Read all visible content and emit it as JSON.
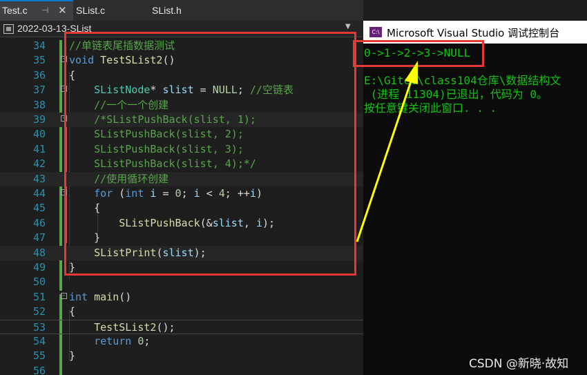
{
  "tabs": [
    {
      "label": "Test.c",
      "active": true
    },
    {
      "label": "SList.c",
      "active": false
    },
    {
      "label": "SList.h",
      "active": false
    }
  ],
  "tab_pin": "⊣",
  "tab_close": "✕",
  "nav": {
    "project": "2022-03-13-SList"
  },
  "code_lines": [
    {
      "num": "34",
      "tokens": [
        {
          "t": "//单链表尾插数据测试",
          "c": "c"
        }
      ]
    },
    {
      "num": "35",
      "fold": "-",
      "tokens": [
        {
          "t": "void ",
          "c": "k"
        },
        {
          "t": "TestSList2",
          "c": "f"
        },
        {
          "t": "()",
          "c": ""
        }
      ]
    },
    {
      "num": "36",
      "tokens": [
        {
          "t": "{",
          "c": ""
        }
      ]
    },
    {
      "num": "37",
      "fold": "-",
      "tokens": [
        {
          "t": "    ",
          "c": ""
        },
        {
          "t": "SListNode",
          "c": "t"
        },
        {
          "t": "* ",
          "c": ""
        },
        {
          "t": "slist",
          "c": "v"
        },
        {
          "t": " = ",
          "c": ""
        },
        {
          "t": "NULL",
          "c": "m"
        },
        {
          "t": "; ",
          "c": ""
        },
        {
          "t": "//空链表",
          "c": "c"
        }
      ]
    },
    {
      "num": "38",
      "tokens": [
        {
          "t": "    ",
          "c": ""
        },
        {
          "t": "//一个一个创建",
          "c": "c"
        }
      ]
    },
    {
      "num": "39",
      "fold": "-",
      "tokens": [
        {
          "t": "    ",
          "c": ""
        },
        {
          "t": "/*SListPushBack(slist, 1);",
          "c": "c"
        }
      ]
    },
    {
      "num": "40",
      "tokens": [
        {
          "t": "    ",
          "c": ""
        },
        {
          "t": "SListPushBack(slist, 2);",
          "c": "c"
        }
      ]
    },
    {
      "num": "41",
      "tokens": [
        {
          "t": "    ",
          "c": ""
        },
        {
          "t": "SListPushBack(slist, 3);",
          "c": "c"
        }
      ]
    },
    {
      "num": "42",
      "tokens": [
        {
          "t": "    ",
          "c": ""
        },
        {
          "t": "SListPushBack(slist, 4);*/",
          "c": "c"
        }
      ]
    },
    {
      "num": "43",
      "tokens": [
        {
          "t": "    ",
          "c": ""
        },
        {
          "t": "//使用循环创建",
          "c": "c"
        }
      ]
    },
    {
      "num": "44",
      "fold": "-",
      "tokens": [
        {
          "t": "    ",
          "c": ""
        },
        {
          "t": "for",
          "c": "k"
        },
        {
          "t": " (",
          "c": ""
        },
        {
          "t": "int",
          "c": "k"
        },
        {
          "t": " ",
          "c": ""
        },
        {
          "t": "i",
          "c": "v"
        },
        {
          "t": " = ",
          "c": ""
        },
        {
          "t": "0",
          "c": "n"
        },
        {
          "t": "; ",
          "c": ""
        },
        {
          "t": "i",
          "c": "v"
        },
        {
          "t": " < ",
          "c": ""
        },
        {
          "t": "4",
          "c": "n"
        },
        {
          "t": "; ++",
          "c": ""
        },
        {
          "t": "i",
          "c": "v"
        },
        {
          "t": ")",
          "c": ""
        }
      ]
    },
    {
      "num": "45",
      "tokens": [
        {
          "t": "    {",
          "c": ""
        }
      ]
    },
    {
      "num": "46",
      "tokens": [
        {
          "t": "        ",
          "c": ""
        },
        {
          "t": "SListPushBack",
          "c": "f"
        },
        {
          "t": "(&",
          "c": ""
        },
        {
          "t": "slist",
          "c": "v"
        },
        {
          "t": ", ",
          "c": ""
        },
        {
          "t": "i",
          "c": "v"
        },
        {
          "t": ");",
          "c": ""
        }
      ]
    },
    {
      "num": "47",
      "tokens": [
        {
          "t": "    }",
          "c": ""
        }
      ]
    },
    {
      "num": "48",
      "tokens": [
        {
          "t": "    ",
          "c": ""
        },
        {
          "t": "SListPrint",
          "c": "f"
        },
        {
          "t": "(",
          "c": ""
        },
        {
          "t": "slist",
          "c": "v"
        },
        {
          "t": ");",
          "c": ""
        }
      ]
    },
    {
      "num": "49",
      "tokens": [
        {
          "t": "}",
          "c": ""
        }
      ]
    },
    {
      "num": "50",
      "tokens": []
    },
    {
      "num": "51",
      "fold": "-",
      "tokens": [
        {
          "t": "int",
          "c": "k"
        },
        {
          "t": " ",
          "c": ""
        },
        {
          "t": "main",
          "c": "f"
        },
        {
          "t": "()",
          "c": ""
        }
      ]
    },
    {
      "num": "52",
      "tokens": [
        {
          "t": "{",
          "c": ""
        }
      ]
    },
    {
      "num": "53",
      "tokens": [
        {
          "t": "    ",
          "c": ""
        },
        {
          "t": "TestSList2",
          "c": "f"
        },
        {
          "t": "();",
          "c": ""
        }
      ]
    },
    {
      "num": "54",
      "tokens": [
        {
          "t": "    ",
          "c": ""
        },
        {
          "t": "return",
          "c": "k"
        },
        {
          "t": " ",
          "c": ""
        },
        {
          "t": "0",
          "c": "n"
        },
        {
          "t": ";",
          "c": ""
        }
      ]
    },
    {
      "num": "55",
      "tokens": [
        {
          "t": "}",
          "c": ""
        }
      ]
    },
    {
      "num": "56",
      "tokens": []
    }
  ],
  "console": {
    "icon": "C:\\",
    "title": "Microsoft Visual Studio 调试控制台",
    "lines": [
      "0->1->2->3->NULL",
      "",
      "E:\\Gitee\\class104仓库\\数据结构文",
      " (进程 11304)已退出，代码为 0。",
      "按任意键关闭此窗口. . ."
    ]
  },
  "watermark": "CSDN @新晓·故知",
  "colors": {
    "annotation_red": "#e53935",
    "arrow_yellow": "#ffff00",
    "console_green": "#13c313"
  }
}
